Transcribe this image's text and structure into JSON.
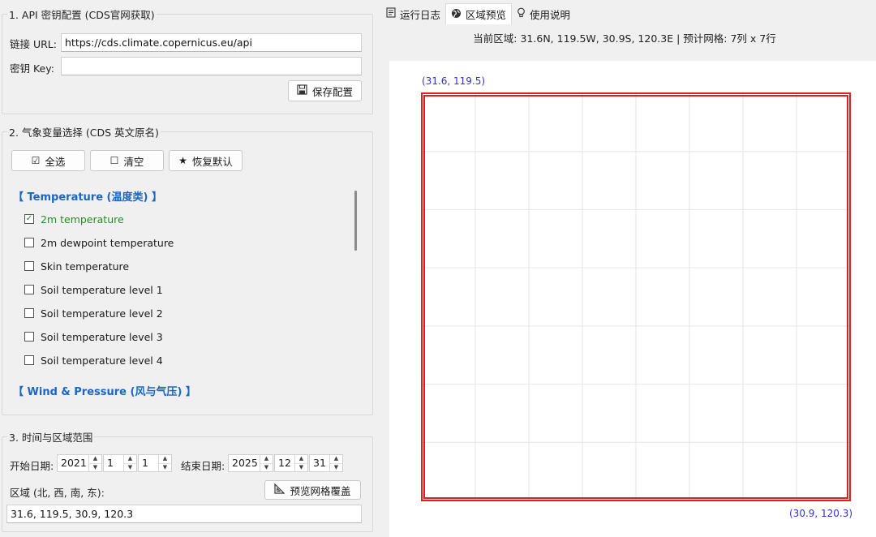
{
  "api_section": {
    "title": "1. API 密钥配置 (CDS官网获取)",
    "url_label": "链接 URL:",
    "url_value": "https://cds.climate.copernicus.eu/api",
    "key_label": "密钥 Key:",
    "key_value": "",
    "save_button": "保存配置"
  },
  "vars_section": {
    "title": "2. 气象变量选择 (CDS 英文原名)",
    "select_all": "全选",
    "clear": "清空",
    "restore_default": "恢复默认",
    "groups": [
      {
        "header": "【 Temperature (温度类) 】",
        "items": [
          {
            "label": "2m temperature",
            "checked": true
          },
          {
            "label": "2m dewpoint temperature",
            "checked": false
          },
          {
            "label": "Skin temperature",
            "checked": false
          },
          {
            "label": "Soil temperature level 1",
            "checked": false
          },
          {
            "label": "Soil temperature level 2",
            "checked": false
          },
          {
            "label": "Soil temperature level 3",
            "checked": false
          },
          {
            "label": "Soil temperature level 4",
            "checked": false
          }
        ]
      },
      {
        "header": "【 Wind & Pressure (风与气压) 】",
        "items": []
      }
    ]
  },
  "time_section": {
    "title": "3. 时间与区域范围",
    "start_label": "开始日期:",
    "start_year": "2021",
    "start_month": "1",
    "start_day": "1",
    "end_label": "结束日期:",
    "end_year": "2025",
    "end_month": "12",
    "end_day": "31",
    "region_label": "区域 (北, 西, 南, 东):",
    "preview_button": "预览网格覆盖",
    "region_value": "31.6, 119.5, 30.9, 120.3"
  },
  "tabs": [
    {
      "label": "运行日志",
      "icon": "log-icon"
    },
    {
      "label": "区域预览",
      "icon": "globe-icon",
      "active": true
    },
    {
      "label": "使用说明",
      "icon": "bulb-icon"
    }
  ],
  "preview": {
    "region_info": "当前区域: 31.6N, 119.5W, 30.9S, 120.3E | 预计网格: 7列 x 7行",
    "top_left_label": "(31.6, 119.5)",
    "bottom_right_label": "(30.9, 120.3)",
    "grid_cols": 8,
    "grid_rows": 7,
    "border_color": "#e02020",
    "grid_color": "#e6e6e6",
    "label_color": "#3333cc"
  }
}
